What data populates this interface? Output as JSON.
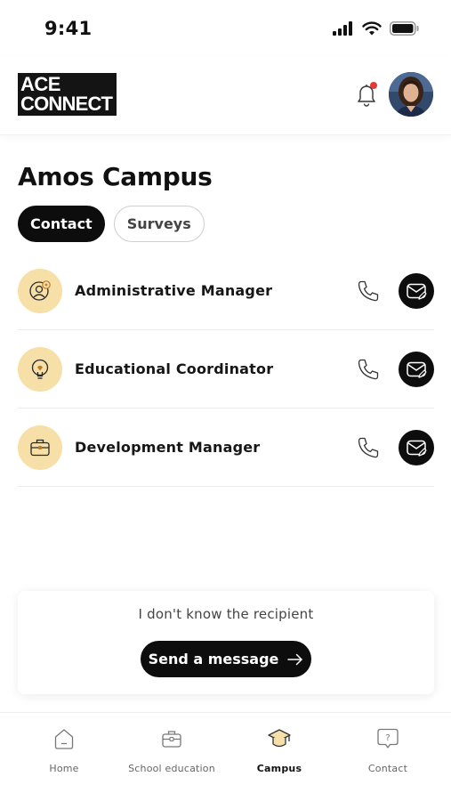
{
  "status_bar": {
    "time": "9:41"
  },
  "header": {
    "logo_line1": "ACE",
    "logo_line2": "CONNECT",
    "notification_badge": true,
    "colors": {
      "badge": "#e53935",
      "accent": "#f6e0a8",
      "dark": "#0d0d0d"
    }
  },
  "page": {
    "title": "Amos Campus",
    "tabs": [
      {
        "label": "Contact",
        "active": true
      },
      {
        "label": "Surveys",
        "active": false
      }
    ]
  },
  "contacts": [
    {
      "name": "Administrative Manager",
      "icon": "admin-person-icon"
    },
    {
      "name": "Educational Coordinator",
      "icon": "lightbulb-icon"
    },
    {
      "name": "Development Manager",
      "icon": "briefcase-icon"
    }
  ],
  "recipient_card": {
    "text": "I don't know the recipient",
    "button_label": "Send a message",
    "button_icon": "arrow-right-icon"
  },
  "bottom_nav": {
    "items": [
      {
        "label": "Home",
        "icon": "home-icon",
        "active": false
      },
      {
        "label": "School education",
        "icon": "briefcase-icon",
        "active": false
      },
      {
        "label": "Campus",
        "icon": "graduation-cap-icon",
        "active": true
      },
      {
        "label": "Contact",
        "icon": "question-bubble-icon",
        "active": false
      }
    ]
  }
}
